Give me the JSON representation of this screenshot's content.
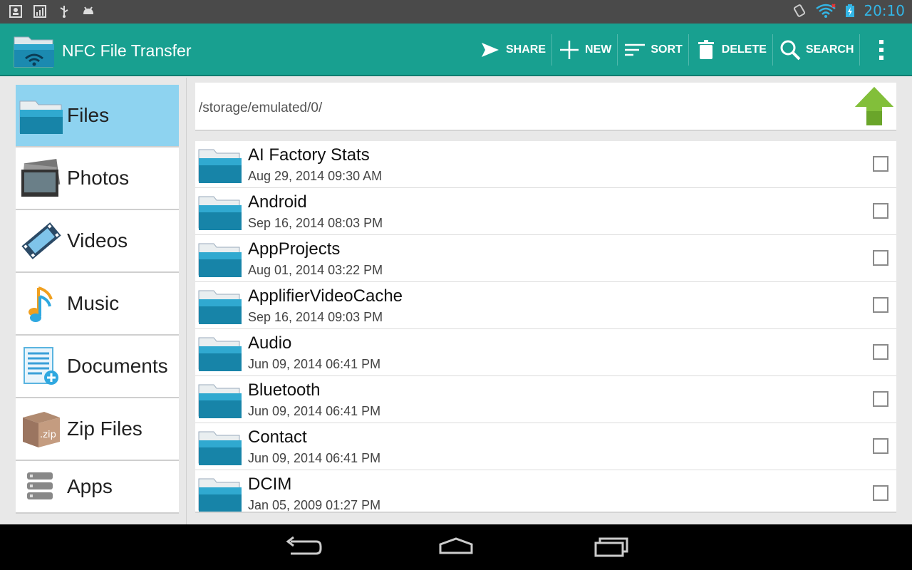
{
  "status_bar": {
    "left_icons": [
      "contacts-icon",
      "signal-chart-icon",
      "usb-icon",
      "android-icon"
    ],
    "right_icons": [
      "rotate-icon",
      "wifi-icon",
      "battery-charging-icon"
    ],
    "time": "20:10"
  },
  "app": {
    "title": "NFC File Transfer",
    "icon": "nfc-folder-icon"
  },
  "actions": [
    {
      "label": "SHARE",
      "icon": "share-icon"
    },
    {
      "label": "NEW",
      "icon": "plus-icon"
    },
    {
      "label": "SORT",
      "icon": "sort-icon"
    },
    {
      "label": "DELETE",
      "icon": "trash-icon"
    },
    {
      "label": "SEARCH",
      "icon": "search-icon"
    }
  ],
  "sidebar": {
    "items": [
      {
        "label": "Files",
        "icon": "folder-icon",
        "active": true
      },
      {
        "label": "Photos",
        "icon": "photos-icon",
        "active": false
      },
      {
        "label": "Videos",
        "icon": "film-icon",
        "active": false
      },
      {
        "label": "Music",
        "icon": "music-note-icon",
        "active": false
      },
      {
        "label": "Documents",
        "icon": "document-icon",
        "active": false
      },
      {
        "label": "Zip Files",
        "icon": "zip-box-icon",
        "active": false
      },
      {
        "label": "Apps",
        "icon": "apps-stack-icon",
        "active": false
      }
    ]
  },
  "path": "/storage/emulated/0/",
  "files": [
    {
      "name": "AI Factory Stats",
      "date": "Aug 29, 2014 09:30 AM",
      "checked": false
    },
    {
      "name": "Android",
      "date": "Sep 16, 2014 08:03 PM",
      "checked": false
    },
    {
      "name": "AppProjects",
      "date": "Aug 01, 2014 03:22 PM",
      "checked": false
    },
    {
      "name": "ApplifierVideoCache",
      "date": "Sep 16, 2014 09:03 PM",
      "checked": false
    },
    {
      "name": "Audio",
      "date": "Jun 09, 2014 06:41 PM",
      "checked": false
    },
    {
      "name": "Bluetooth",
      "date": "Jun 09, 2014 06:41 PM",
      "checked": false
    },
    {
      "name": "Contact",
      "date": "Jun 09, 2014 06:41 PM",
      "checked": false
    },
    {
      "name": "DCIM",
      "date": "Jan 05, 2009 01:27 PM",
      "checked": false
    }
  ],
  "colors": {
    "action_bar": "#18a090",
    "active_nav": "#8ed3f0",
    "clock": "#33b5e5",
    "up_arrow": "#6aa52a"
  }
}
